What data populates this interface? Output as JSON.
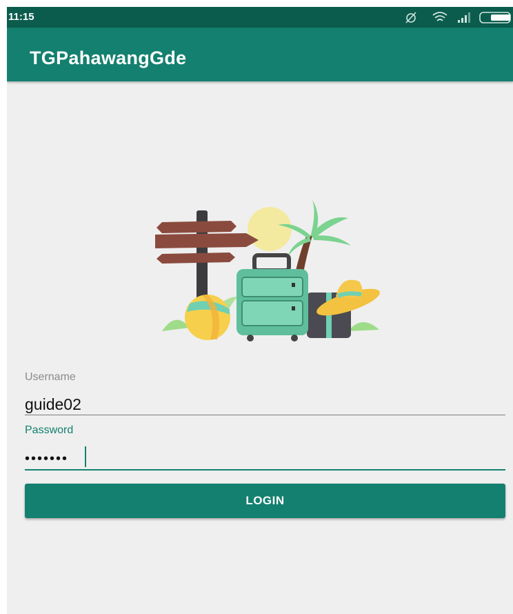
{
  "status_bar": {
    "time": "11:15",
    "icons": [
      "alarm-icon",
      "wifi-icon",
      "signal-icon",
      "battery-icon"
    ]
  },
  "app_bar": {
    "title": "TGPahawangGde"
  },
  "illustration": {
    "name": "travel-illustration"
  },
  "form": {
    "username_label": "Username",
    "username_value": "guide02",
    "password_label": "Password",
    "password_value": "•••••••",
    "login_label": "LOGIN"
  },
  "colors": {
    "primary": "#14806f",
    "primary_dark": "#0b5c4d",
    "background": "#efefef"
  }
}
